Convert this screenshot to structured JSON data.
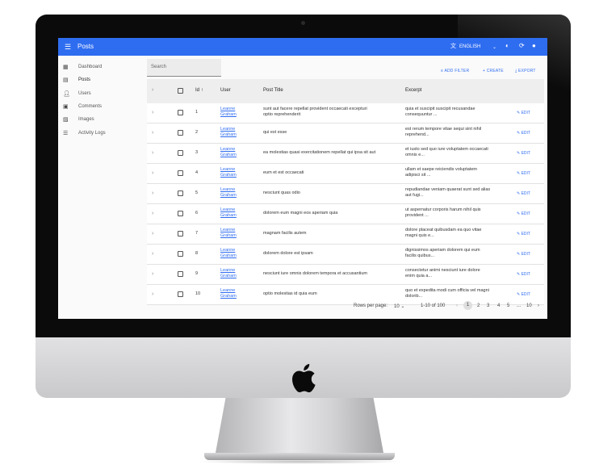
{
  "appbar": {
    "title": "Posts",
    "language": "ENGLISH"
  },
  "sidebar": {
    "items": [
      {
        "label": "Dashboard",
        "icon": "dashboard-icon"
      },
      {
        "label": "Posts",
        "icon": "posts-icon"
      },
      {
        "label": "Users",
        "icon": "person-icon"
      },
      {
        "label": "Comments",
        "icon": "comment-icon"
      },
      {
        "label": "Images",
        "icon": "image-icon"
      },
      {
        "label": "Activity Logs",
        "icon": "list-icon"
      }
    ]
  },
  "search": {
    "placeholder": "Search"
  },
  "actions": {
    "add_filter": "ADD FILTER",
    "create": "CREATE",
    "export": "EXPORT"
  },
  "table": {
    "headers": {
      "id": "Id",
      "user": "User",
      "post_title": "Post Title",
      "excerpt": "Excerpt"
    },
    "edit_label": "EDIT",
    "rows": [
      {
        "id": "1",
        "user1": "Leanne",
        "user2": "Graham",
        "title1": "sunt aut facere repellat provident occaecati excepturi",
        "title2": "optio reprehenderit",
        "ex1": "quia et suscipit suscipit recusandae",
        "ex2": "consequuntur ..."
      },
      {
        "id": "2",
        "user1": "Leanne",
        "user2": "Graham",
        "title1": "qui est esse",
        "title2": "",
        "ex1": "est rerum tempore vitae sequi sint nihil",
        "ex2": "reprehend..."
      },
      {
        "id": "3",
        "user1": "Leanne",
        "user2": "Graham",
        "title1": "ea molestias quasi exercitationem repellat qui ipsa sit aut",
        "title2": "",
        "ex1": "et iusto sed quo iure voluptatem occaecati",
        "ex2": "omnis e..."
      },
      {
        "id": "4",
        "user1": "Leanne",
        "user2": "Graham",
        "title1": "eum et est occaecati",
        "title2": "",
        "ex1": "ullam et saepe reiciendis voluptatem",
        "ex2": "adipisci sit ..."
      },
      {
        "id": "5",
        "user1": "Leanne",
        "user2": "Graham",
        "title1": "nesciunt quas odio",
        "title2": "",
        "ex1": "repudiandae veniam quaerat sunt sed alias",
        "ex2": "aut fugi..."
      },
      {
        "id": "6",
        "user1": "Leanne",
        "user2": "Graham",
        "title1": "dolorem eum magni eos aperiam quia",
        "title2": "",
        "ex1": "ut aspernatur corporis harum nihil quis",
        "ex2": "provident ..."
      },
      {
        "id": "7",
        "user1": "Leanne",
        "user2": "Graham",
        "title1": "magnam facilis autem",
        "title2": "",
        "ex1": "dolore placeat quibusdam ea quo vitae",
        "ex2": "magni quis e..."
      },
      {
        "id": "8",
        "user1": "Leanne",
        "user2": "Graham",
        "title1": "dolorem dolore est ipsam",
        "title2": "",
        "ex1": "dignissimos aperiam dolorem qui eum",
        "ex2": "facilis quibus..."
      },
      {
        "id": "9",
        "user1": "Leanne",
        "user2": "Graham",
        "title1": "nesciunt iure omnis dolorem tempora et accusantium",
        "title2": "",
        "ex1": "consectetur animi nesciunt iure dolore",
        "ex2": "enim quia a..."
      },
      {
        "id": "10",
        "user1": "Leanne",
        "user2": "Graham",
        "title1": "optio molestias id quia eum",
        "title2": "",
        "ex1": "quo et expedita modi cum officia vel magni",
        "ex2": "dolorib..."
      }
    ]
  },
  "pagination": {
    "rows_per_page_label": "Rows per page:",
    "rows_per_page": "10",
    "range": "1-10 of 100",
    "pages": [
      "1",
      "2",
      "3",
      "4",
      "5",
      "...",
      "10"
    ],
    "current": "1"
  }
}
